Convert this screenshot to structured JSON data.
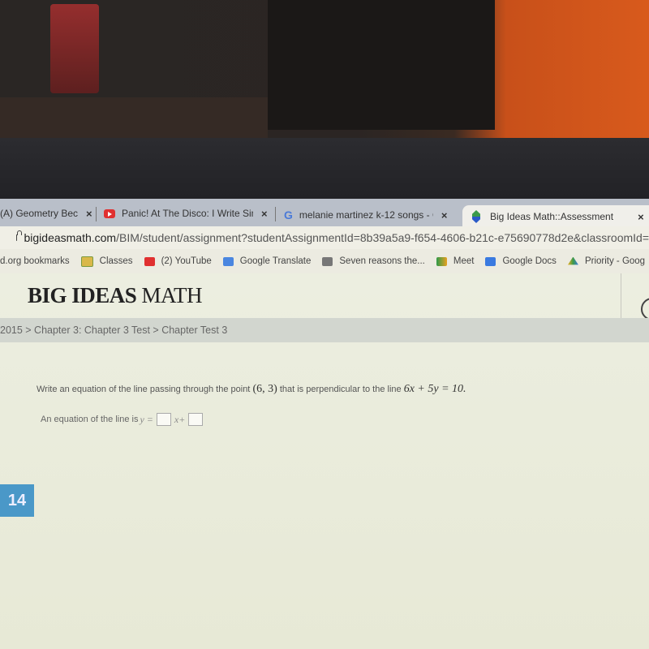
{
  "browser": {
    "tabs": [
      {
        "title": "(A) Geometry Bec",
        "icon": "generic-icon",
        "active": false
      },
      {
        "title": "Panic! At The Disco: I Write Sins",
        "icon": "youtube-icon",
        "active": false
      },
      {
        "title": "melanie martinez k-12 songs - G",
        "icon": "google-icon",
        "active": false
      },
      {
        "title": "Big Ideas Math::Assessment",
        "icon": "big-ideas-icon",
        "active": true
      }
    ],
    "close_glyph": "×",
    "url_host": "bigideasmath.com",
    "url_path": "/BIM/student/assignment?studentAssignmentId=8b39a5a9-f654-4606-b21c-e75690778d2e&classroomId=",
    "bookmarks": [
      {
        "label": "d.org bookmarks",
        "icon": "none"
      },
      {
        "label": "Classes",
        "icon": "classroom-icon"
      },
      {
        "label": "(2) YouTube",
        "icon": "youtube-icon"
      },
      {
        "label": "Google Translate",
        "icon": "translate-icon"
      },
      {
        "label": "Seven reasons the...",
        "icon": "web-icon"
      },
      {
        "label": "Meet",
        "icon": "meet-icon"
      },
      {
        "label": "Google Docs",
        "icon": "docs-icon"
      },
      {
        "label": "Priority - Goog",
        "icon": "drive-icon"
      }
    ]
  },
  "page": {
    "brand_bold": "BIG IDEAS",
    "brand_light": " MATH",
    "breadcrumb": "2015 > Chapter 3: Chapter 3 Test > Chapter Test 3",
    "question_prefix": "Write an equation of the line passing through the point ",
    "question_point": "(6, 3)",
    "question_middle": " that is perpendicular to the line ",
    "question_line": "6x + 5y = 10.",
    "answer_prefix": "An equation of the line is ",
    "answer_y": "y =",
    "answer_x": "x+",
    "question_number": "14"
  }
}
